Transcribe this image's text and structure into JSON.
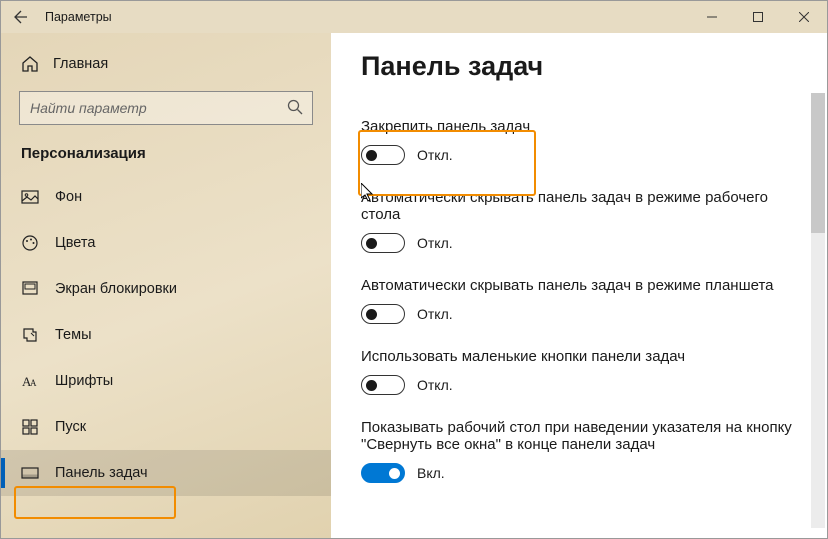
{
  "titlebar": {
    "title": "Параметры"
  },
  "sidebar": {
    "home": "Главная",
    "search_placeholder": "Найти параметр",
    "section": "Персонализация",
    "items": [
      {
        "label": "Фон"
      },
      {
        "label": "Цвета"
      },
      {
        "label": "Экран блокировки"
      },
      {
        "label": "Темы"
      },
      {
        "label": "Шрифты"
      },
      {
        "label": "Пуск"
      },
      {
        "label": "Панель задач"
      }
    ]
  },
  "content": {
    "title": "Панель задач",
    "settings": [
      {
        "label": "Закрепить панель задач",
        "state": "Откл.",
        "on": false
      },
      {
        "label": "Автоматически скрывать панель задач в режиме рабочего стола",
        "state": "Откл.",
        "on": false
      },
      {
        "label": "Автоматически скрывать панель задач в режиме планшета",
        "state": "Откл.",
        "on": false
      },
      {
        "label": "Использовать маленькие кнопки панели задач",
        "state": "Откл.",
        "on": false
      },
      {
        "label": "Показывать рабочий стол при наведении указателя на кнопку \"Свернуть все окна\" в конце панели задач",
        "state": "Вкл.",
        "on": true
      }
    ]
  }
}
